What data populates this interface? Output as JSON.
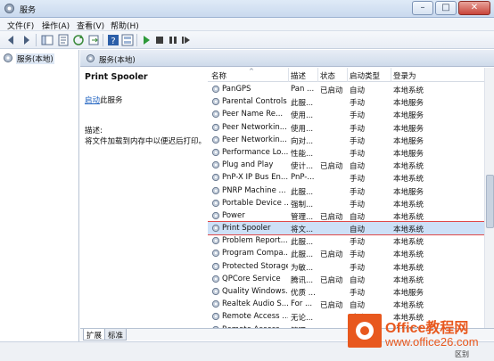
{
  "window": {
    "title": "服务"
  },
  "menu": [
    "文件(F)",
    "操作(A)",
    "查看(V)",
    "帮助(H)"
  ],
  "toolbar": {
    "icons": [
      "back-icon",
      "forward-icon",
      "show-hide-tree-icon",
      "properties-icon",
      "refresh-icon",
      "export-icon",
      "help-icon",
      "view-icon",
      "start-icon",
      "stop-icon",
      "pause-icon",
      "restart-icon"
    ]
  },
  "tree": {
    "root": "服务(本地)"
  },
  "pane": {
    "header": "服务(本地)"
  },
  "details": {
    "service_name": "Print Spooler",
    "action_link": "启动",
    "action_suffix": "此服务",
    "description_label": "描述:",
    "description_text": "将文件加载到内存中以便迟后打印。"
  },
  "columns": {
    "name": "名称",
    "description": "描述",
    "status": "状态",
    "startup": "启动类型",
    "logon": "登录为"
  },
  "rows": [
    {
      "name": "PanGPS",
      "desc": "Pan ...",
      "status": "已启动",
      "startup": "自动",
      "logon": "本地系统"
    },
    {
      "name": "Parental Controls",
      "desc": "此服...",
      "status": "",
      "startup": "手动",
      "logon": "本地服务"
    },
    {
      "name": "Peer Name Re...",
      "desc": "使用...",
      "status": "",
      "startup": "手动",
      "logon": "本地服务"
    },
    {
      "name": "Peer Networkin...",
      "desc": "使用...",
      "status": "",
      "startup": "手动",
      "logon": "本地服务"
    },
    {
      "name": "Peer Networkin...",
      "desc": "向对...",
      "status": "",
      "startup": "手动",
      "logon": "本地服务"
    },
    {
      "name": "Performance Lo...",
      "desc": "性能...",
      "status": "",
      "startup": "手动",
      "logon": "本地服务"
    },
    {
      "name": "Plug and Play",
      "desc": "使计...",
      "status": "已启动",
      "startup": "自动",
      "logon": "本地系统"
    },
    {
      "name": "PnP-X IP Bus En...",
      "desc": "PnP-...",
      "status": "",
      "startup": "手动",
      "logon": "本地系统"
    },
    {
      "name": "PNRP Machine ...",
      "desc": "此服...",
      "status": "",
      "startup": "手动",
      "logon": "本地服务"
    },
    {
      "name": "Portable Device ...",
      "desc": "强制...",
      "status": "",
      "startup": "手动",
      "logon": "本地系统"
    },
    {
      "name": "Power",
      "desc": "管理...",
      "status": "已启动",
      "startup": "自动",
      "logon": "本地系统"
    },
    {
      "name": "Print Spooler",
      "desc": "将文...",
      "status": "",
      "startup": "自动",
      "logon": "本地系统",
      "selected": true
    },
    {
      "name": "Problem Report...",
      "desc": "此服...",
      "status": "",
      "startup": "手动",
      "logon": "本地系统"
    },
    {
      "name": "Program Compa...",
      "desc": "此服...",
      "status": "已启动",
      "startup": "手动",
      "logon": "本地系统"
    },
    {
      "name": "Protected Storage",
      "desc": "为敏...",
      "status": "",
      "startup": "手动",
      "logon": "本地系统"
    },
    {
      "name": "QPCore Service",
      "desc": "腾讯...",
      "status": "已启动",
      "startup": "自动",
      "logon": "本地系统"
    },
    {
      "name": "Quality Windows...",
      "desc": "优质 ...",
      "status": "",
      "startup": "手动",
      "logon": "本地服务"
    },
    {
      "name": "Realtek Audio S...",
      "desc": "For ...",
      "status": "已启动",
      "startup": "自动",
      "logon": "本地系统"
    },
    {
      "name": "Remote Access ...",
      "desc": "无论...",
      "status": "",
      "startup": "手动",
      "logon": "本地系统"
    },
    {
      "name": "Remote Access ...",
      "desc": "管理...",
      "status": "",
      "startup": "手动",
      "logon": "本地系统"
    }
  ],
  "tabs": [
    "扩展",
    "标准"
  ],
  "watermark": {
    "brand": "Office教程网",
    "url": "www.office26.com",
    "note": "区别"
  },
  "colors": {
    "selection": "#cde0f7",
    "highlight_border": "#e04848",
    "link": "#1b5fbf",
    "brand": "#e8581e"
  }
}
